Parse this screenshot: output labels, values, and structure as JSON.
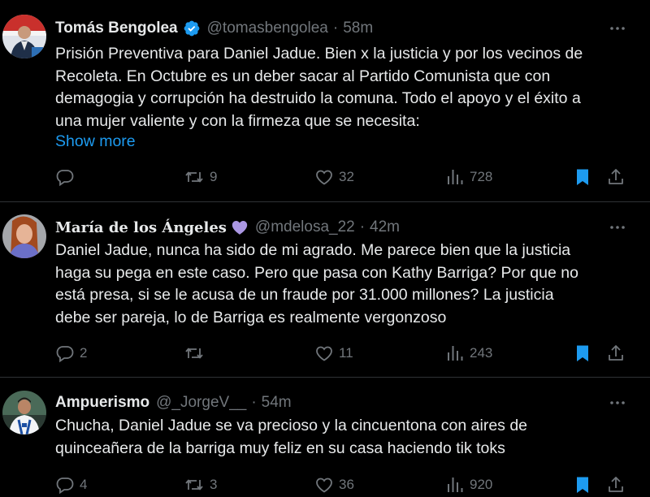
{
  "colors": {
    "background": "#000000",
    "text": "#e7e9ea",
    "muted": "#71767b",
    "link": "#1d9bf0",
    "verified": "#1d9bf0",
    "bookmark_active": "#1d9bf0",
    "heart_purple": "#ab97e3",
    "divider": "#2f3336"
  },
  "tweets": [
    {
      "name": "Tomás Bengolea",
      "verified": true,
      "handle": "@tomasbengolea",
      "separator": "·",
      "time": "58m",
      "text_lines": [
        "Prisión Preventiva para Daniel Jadue. Bien x la justicia y por los vecinos de",
        "Recoleta. En Octubre es un deber sacar al Partido Comunista que con",
        "demagogia y corrupción ha destruido la comuna. Todo el apoyo y el éxito a",
        "una mujer valiente y con la firmeza que se necesita:"
      ],
      "show_more": "Show more",
      "actions": {
        "replies": "",
        "retweets": "9",
        "likes": "32",
        "views": "728",
        "bookmarked": true
      },
      "icons": [
        "reply-icon",
        "retweet-icon",
        "heart-icon",
        "views-icon",
        "bookmark-icon",
        "share-icon",
        "more-icon",
        "verified-badge-icon"
      ]
    },
    {
      "name": "María de los Ángeles",
      "name_emoji": "purple-heart-icon",
      "handle": "@mdelosa_22",
      "separator": "·",
      "time": "42m",
      "text_lines": [
        "Daniel Jadue, nunca ha sido de mi agrado. Me parece bien que la justicia",
        "haga su pega en este caso. Pero que pasa con Kathy Barriga? Por que no",
        "está presa, si se le acusa de un fraude por 31.000 millones? La justicia",
        "debe ser pareja, lo de Barriga es realmente vergonzoso"
      ],
      "actions": {
        "replies": "2",
        "retweets": "",
        "likes": "11",
        "views": "243",
        "bookmarked": true
      }
    },
    {
      "name": "Ampuerismo",
      "handle": "@_JorgeV__",
      "separator": "·",
      "time": "54m",
      "text_lines": [
        "Chucha, Daniel Jadue se va precioso y la cincuentona con aires de",
        "quinceañera de la barriga muy feliz en su casa haciendo tik toks"
      ],
      "actions": {
        "replies": "4",
        "retweets": "3",
        "likes": "36",
        "views": "920",
        "bookmarked": true
      }
    }
  ]
}
